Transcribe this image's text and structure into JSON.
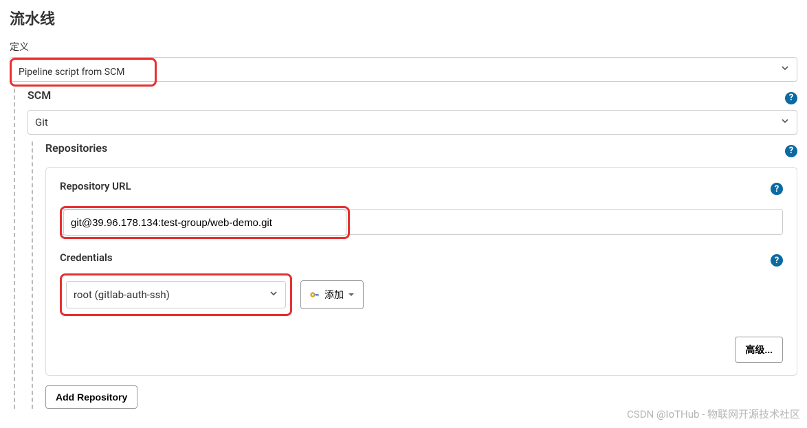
{
  "section_title": "流水线",
  "definition_label": "定义",
  "definition_select": "Pipeline script from SCM",
  "scm_label": "SCM",
  "scm_select": "Git",
  "repositories_label": "Repositories",
  "repo_url_label": "Repository URL",
  "repo_url_value": "git@39.96.178.134:test-group/web-demo.git",
  "credentials_label": "Credentials",
  "credentials_value": "root (gitlab-auth-ssh)",
  "add_credential_label": "添加",
  "advanced_button": "高级...",
  "add_repository_button": "Add Repository",
  "watermark": "CSDN @IoTHub - 物联网开源技术社区",
  "help_tooltip": "?"
}
